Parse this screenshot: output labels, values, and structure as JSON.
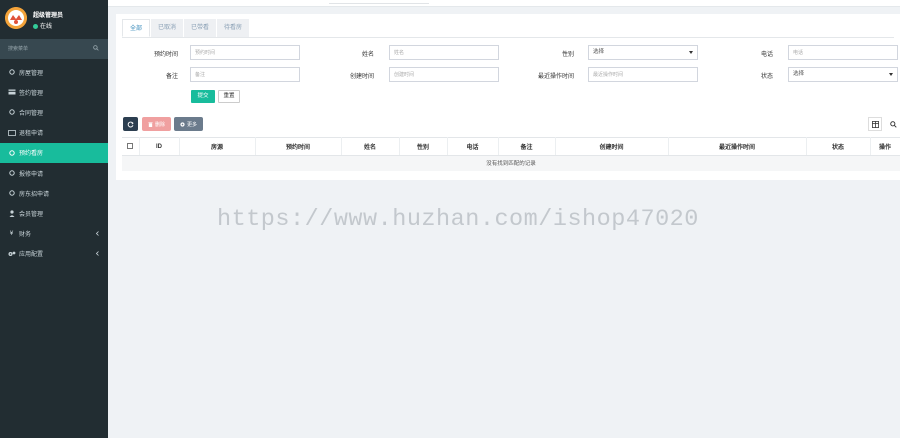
{
  "user": {
    "name": "超级管理员",
    "status": "在线"
  },
  "sidebar": {
    "search_placeholder": "搜索菜单",
    "items": [
      {
        "label": "房屋管理",
        "icon": "circle-icon"
      },
      {
        "label": "签约管理",
        "icon": "card-icon"
      },
      {
        "label": "合同管理",
        "icon": "circle-icon"
      },
      {
        "label": "退租申请",
        "icon": "card-outline-icon"
      },
      {
        "label": "预约看房",
        "icon": "circle-icon",
        "active": true
      },
      {
        "label": "报修申请",
        "icon": "circle-icon"
      },
      {
        "label": "房东招申请",
        "icon": "circle-icon"
      },
      {
        "label": "会员管理",
        "icon": "user-icon"
      },
      {
        "label": "财务",
        "icon": "yen-icon",
        "has_children": true
      },
      {
        "label": "应用配置",
        "icon": "cogs-icon",
        "has_children": true
      }
    ]
  },
  "tabs": [
    {
      "label": "全部",
      "active": true
    },
    {
      "label": "已取消"
    },
    {
      "label": "已带看"
    },
    {
      "label": "待看房"
    }
  ],
  "filters": {
    "appointment_time": {
      "label": "预约时间",
      "placeholder": "预约时间"
    },
    "name": {
      "label": "姓名",
      "placeholder": "姓名"
    },
    "gender": {
      "label": "性别",
      "value": "选择"
    },
    "phone": {
      "label": "电话",
      "placeholder": "电话"
    },
    "remark": {
      "label": "备注",
      "placeholder": "备注"
    },
    "create_time": {
      "label": "创建时间",
      "placeholder": "创建时间"
    },
    "last_op_time": {
      "label": "最近操作时间",
      "placeholder": "最近操作时间"
    },
    "status": {
      "label": "状态",
      "value": "选择"
    },
    "submit": "提交",
    "reset": "重置"
  },
  "toolbar": {
    "delete": "删除",
    "more": "更多"
  },
  "table": {
    "columns": [
      "",
      "ID",
      "房源",
      "预约时间",
      "姓名",
      "性别",
      "电话",
      "备注",
      "创建时间",
      "最近操作时间",
      "状态",
      "操作"
    ],
    "empty_text": "没有找到匹配的记录"
  },
  "watermark": "https://www.huzhan.com/ishop47020",
  "colors": {
    "sidebar": "#222d32",
    "accent": "#18bc9c",
    "danger_light": "#f0a0a0"
  }
}
